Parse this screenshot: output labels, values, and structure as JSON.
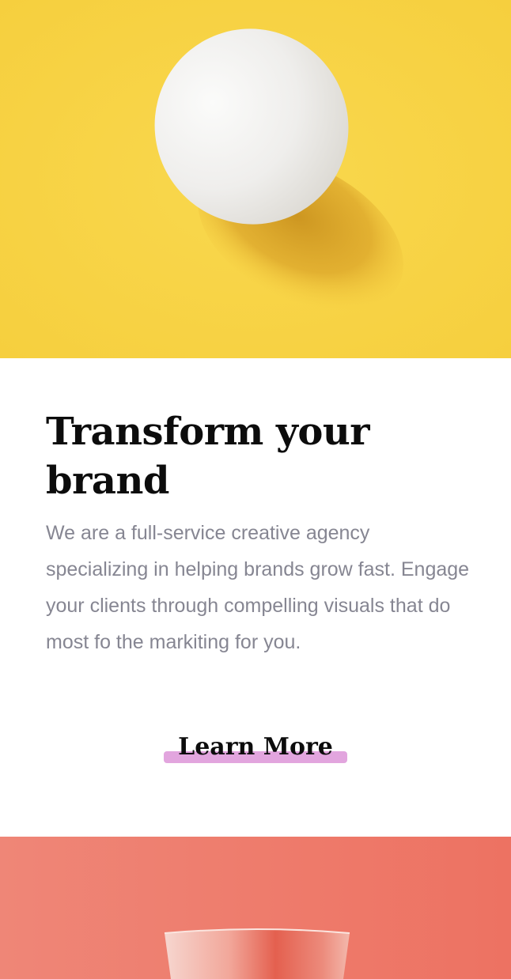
{
  "hero": {
    "image_label": "white-egg-on-yellow",
    "background_color": "#f8d54a"
  },
  "content": {
    "headline": "Transform your brand",
    "body": "We are a full-service creative agency specializing in helping brands grow fast. Engage your clients through compelling visuals that do most fo the markiting for you."
  },
  "cta": {
    "label": "Learn More",
    "highlight_color": "#e2a5de"
  },
  "footer_image": {
    "image_label": "pink-cup-on-coral",
    "background_color": "#ee7b6c"
  }
}
